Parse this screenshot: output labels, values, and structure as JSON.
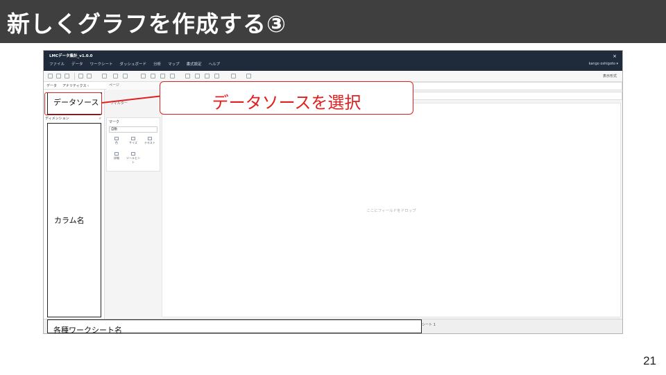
{
  "slide": {
    "title": "新しくグラフを作成する③",
    "page_number": "21"
  },
  "app": {
    "window_title": "LMCデータ集計_v1.0.0",
    "close_icon": "×",
    "menu": [
      "ファイル",
      "データ",
      "ワークシート",
      "ダッシュボード",
      "分析",
      "マップ",
      "書式設定",
      "ヘルプ"
    ],
    "user": "kango oshigoto ▾",
    "show_me": "表示形式",
    "pane_tabs": [
      "データ",
      "アナリティクス ‹"
    ],
    "pages_label": "ページ",
    "filters_label": "フィルター",
    "dimensions_label": "ディメンション",
    "search_icon": "⌕",
    "marks": {
      "title": "マーク",
      "type_selected": "自動",
      "buttons": [
        "色",
        "サイズ",
        "テキスト",
        "詳細",
        "ツールヒント"
      ]
    },
    "drop_hint": "ここにフィールドをドロップ",
    "sheet_tab": "シート 1"
  },
  "annotations": {
    "data_source": "データソース",
    "column_names": "カラム名",
    "worksheet_names": "各種ワークシート名",
    "callout": "データソースを選択"
  },
  "colors": {
    "header_bg": "#3f3f3f",
    "titlebar_bg": "#1f2a3a",
    "accent_red": "#e02020"
  }
}
